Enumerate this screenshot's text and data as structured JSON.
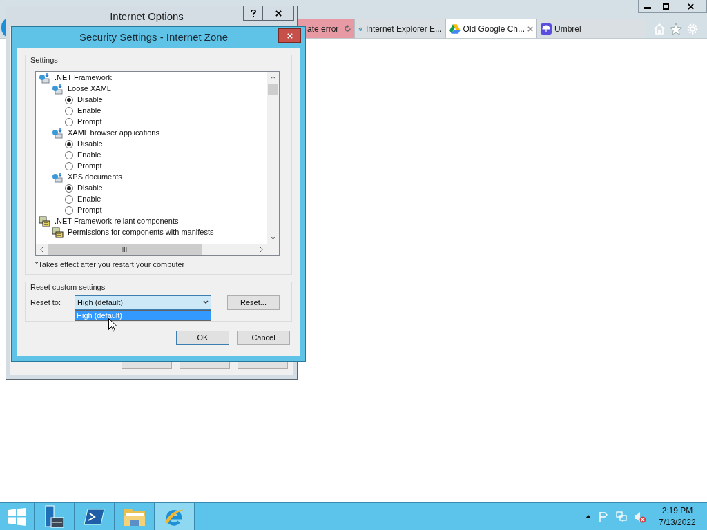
{
  "browser": {
    "tabs": [
      {
        "label": "ate error",
        "kind": "error",
        "selected": false
      },
      {
        "label": "Internet Explorer E...",
        "kind": "ie",
        "selected": false
      },
      {
        "label": "Old Google Ch...",
        "kind": "drive",
        "selected": true
      },
      {
        "label": "Umbrel",
        "kind": "umbrel",
        "selected": false
      }
    ]
  },
  "internet_options": {
    "title": "Internet Options"
  },
  "security_settings": {
    "title": "Security Settings - Internet Zone",
    "settings_group": {
      "label": "Settings",
      "tree": [
        {
          "label": ".NET Framework",
          "kind": "net",
          "children": [
            {
              "label": "Loose XAML",
              "kind": "net",
              "children": [
                {
                  "label": "Disable",
                  "kind": "radio",
                  "selected": true
                },
                {
                  "label": "Enable",
                  "kind": "radio",
                  "selected": false
                },
                {
                  "label": "Prompt",
                  "kind": "radio",
                  "selected": false
                }
              ]
            },
            {
              "label": "XAML browser applications",
              "kind": "net",
              "children": [
                {
                  "label": "Disable",
                  "kind": "radio",
                  "selected": true
                },
                {
                  "label": "Enable",
                  "kind": "radio",
                  "selected": false
                },
                {
                  "label": "Prompt",
                  "kind": "radio",
                  "selected": false
                }
              ]
            },
            {
              "label": "XPS documents",
              "kind": "net",
              "children": [
                {
                  "label": "Disable",
                  "kind": "radio",
                  "selected": true
                },
                {
                  "label": "Enable",
                  "kind": "radio",
                  "selected": false
                },
                {
                  "label": "Prompt",
                  "kind": "radio",
                  "selected": false
                }
              ]
            }
          ]
        },
        {
          "label": ".NET Framework-reliant components",
          "kind": "component",
          "children": [
            {
              "label": "Permissions for components with manifests",
              "kind": "component"
            }
          ]
        }
      ]
    },
    "note": "*Takes effect after you restart your computer",
    "reset_group": {
      "label": "Reset custom settings",
      "reset_to_label": "Reset to:",
      "select": {
        "value": "High (default)",
        "expanded": true,
        "options": [
          {
            "label": "High (default)",
            "selected": true
          }
        ]
      },
      "reset_button": "Reset..."
    },
    "buttons": [
      "OK",
      "Cancel"
    ]
  },
  "taskbar": {
    "apps": [
      {
        "kind": "start",
        "selected": false
      },
      {
        "kind": "server",
        "selected": false
      },
      {
        "kind": "powershell",
        "selected": false
      },
      {
        "kind": "explorer",
        "selected": false
      },
      {
        "kind": "ie",
        "selected": true
      }
    ],
    "clock": {
      "time": "2:19 PM",
      "date": "7/13/2022"
    }
  }
}
